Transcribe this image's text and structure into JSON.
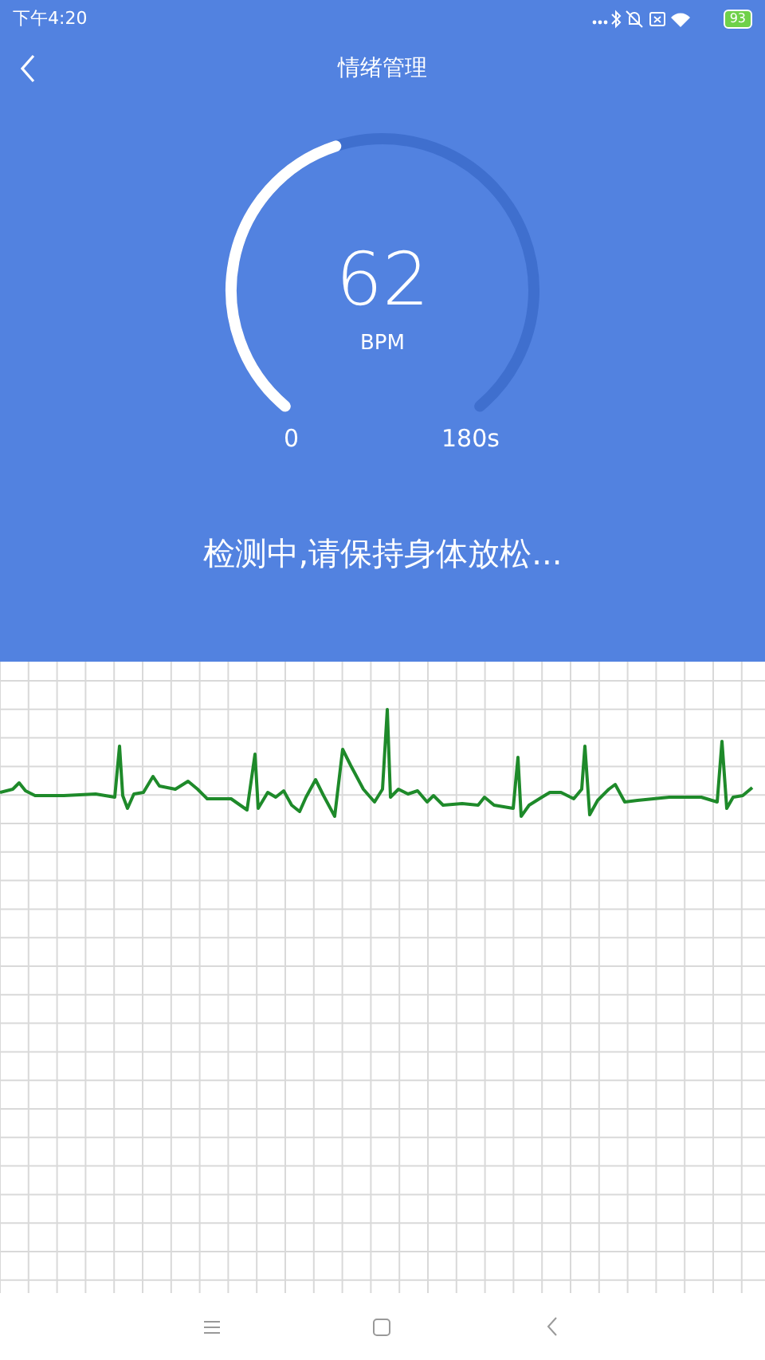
{
  "status_bar": {
    "time": "下午4:20",
    "battery": "93"
  },
  "header": {
    "title": "情绪管理"
  },
  "gauge": {
    "value": "62",
    "unit": "BPM",
    "min_label": "0",
    "max_label": "180s"
  },
  "message": "检测中,请保持身体放松..."
}
